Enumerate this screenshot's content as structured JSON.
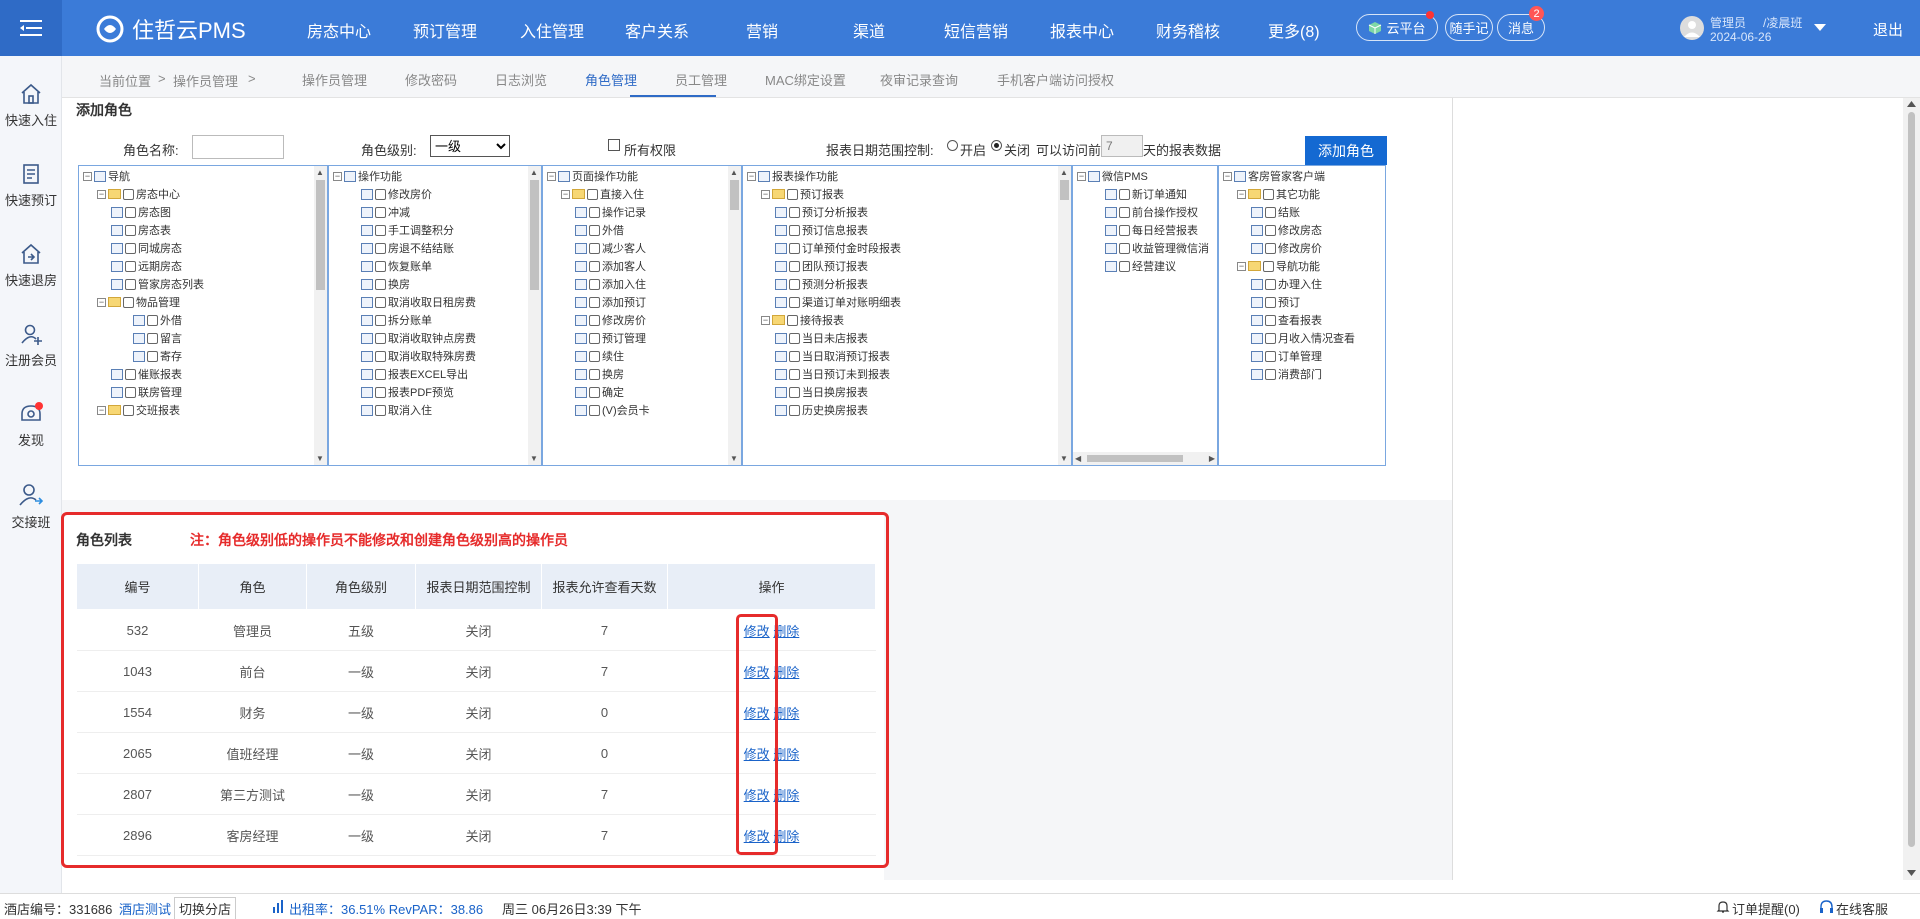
{
  "app": {
    "name": "住哲云PMS"
  },
  "nav": [
    "房态中心",
    "预订管理",
    "入住管理",
    "客户关系",
    "营销",
    "渠道",
    "短信营销",
    "报表中心",
    "财务稽核",
    "更多(8)"
  ],
  "header_actions": {
    "cloud": "云平台",
    "notes": "随手记",
    "messages": "消息",
    "message_count": "2"
  },
  "user": {
    "role": "管理员",
    "shift": "/凌晨班",
    "date": "2024-06-26",
    "logout": "退出"
  },
  "sidebar": [
    {
      "label": "快速入住",
      "icon": "home-icon"
    },
    {
      "label": "快速预订",
      "icon": "clipboard-icon"
    },
    {
      "label": "快速退房",
      "icon": "house-exit-icon"
    },
    {
      "label": "注册会员",
      "icon": "user-add-icon"
    },
    {
      "label": "发现",
      "icon": "discover-icon"
    },
    {
      "label": "交接班",
      "icon": "shift-handover-icon"
    }
  ],
  "breadcrumb": {
    "current": "当前位置",
    "sep": ">",
    "page": "操作员管理",
    "sep2": ">"
  },
  "tabs": [
    "操作员管理",
    "修改密码",
    "日志浏览",
    "角色管理",
    "员工管理",
    "MAC绑定设置",
    "夜审记录查询",
    "手机客户端访问授权"
  ],
  "active_tab": "角色管理",
  "add_role": {
    "title": "添加角色",
    "name_label": "角色名称:",
    "name_value": "",
    "level_label": "角色级别:",
    "level_value": "一级",
    "all_perm_label": "所有权限",
    "report_ctrl_label": "报表日期范围控制:",
    "opt_on": "开启",
    "opt_off": "关闭",
    "days_prefix": "可以访问前",
    "days_value": "7",
    "days_suffix": "天的报表数据",
    "button": "添加角色"
  },
  "trees": [
    {
      "nodes": [
        [
          "导航",
          0,
          "root"
        ],
        [
          "房态中心",
          1,
          "folder"
        ],
        [
          "房态图",
          2,
          "leaf"
        ],
        [
          "房态表",
          2,
          "leaf"
        ],
        [
          "同城房态",
          2,
          "leaf"
        ],
        [
          "远期房态",
          2,
          "leaf"
        ],
        [
          "管家房态列表",
          2,
          "leaf"
        ],
        [
          "物品管理",
          1,
          "folder"
        ],
        [
          "外借",
          3,
          "leaf"
        ],
        [
          "留言",
          3,
          "leaf"
        ],
        [
          "寄存",
          3,
          "leaf"
        ],
        [
          "催账报表",
          2,
          "leaf"
        ],
        [
          "联房管理",
          2,
          "leaf"
        ],
        [
          "交班报表",
          1,
          "folder"
        ]
      ]
    },
    {
      "nodes": [
        [
          "操作功能",
          0,
          "root"
        ],
        [
          "修改房价",
          2,
          "leaf"
        ],
        [
          "冲减",
          2,
          "leaf"
        ],
        [
          "手工调整积分",
          2,
          "leaf"
        ],
        [
          "房退不结结账",
          2,
          "leaf"
        ],
        [
          "恢复账单",
          2,
          "leaf"
        ],
        [
          "换房",
          2,
          "leaf"
        ],
        [
          "取消收取日租房费",
          2,
          "leaf"
        ],
        [
          "拆分账单",
          2,
          "leaf"
        ],
        [
          "取消收取钟点房费",
          2,
          "leaf"
        ],
        [
          "取消收取特殊房费",
          2,
          "leaf"
        ],
        [
          "报表EXCEL导出",
          2,
          "leaf"
        ],
        [
          "报表PDF预览",
          2,
          "leaf"
        ],
        [
          "取消入住",
          2,
          "leaf"
        ]
      ]
    },
    {
      "nodes": [
        [
          "页面操作功能",
          0,
          "root"
        ],
        [
          "直接入住",
          1,
          "folder"
        ],
        [
          "操作记录",
          2,
          "leaf"
        ],
        [
          "外借",
          2,
          "leaf"
        ],
        [
          "减少客人",
          2,
          "leaf"
        ],
        [
          "添加客人",
          2,
          "leaf"
        ],
        [
          "添加入住",
          2,
          "leaf"
        ],
        [
          "添加预订",
          2,
          "leaf"
        ],
        [
          "修改房价",
          2,
          "leaf"
        ],
        [
          "预订管理",
          2,
          "leaf"
        ],
        [
          "续住",
          2,
          "leaf"
        ],
        [
          "换房",
          2,
          "leaf"
        ],
        [
          "确定",
          2,
          "leaf"
        ],
        [
          "(V)会员卡",
          2,
          "leaf"
        ]
      ]
    },
    {
      "nodes": [
        [
          "报表操作功能",
          0,
          "root"
        ],
        [
          "预订报表",
          1,
          "folder"
        ],
        [
          "预订分析报表",
          2,
          "leaf"
        ],
        [
          "预订信息报表",
          2,
          "leaf"
        ],
        [
          "订单预付金时段报表",
          2,
          "leaf"
        ],
        [
          "团队预订报表",
          2,
          "leaf"
        ],
        [
          "预测分析报表",
          2,
          "leaf"
        ],
        [
          "渠道订单对账明细表",
          2,
          "leaf"
        ],
        [
          "接待报表",
          1,
          "folder"
        ],
        [
          "当日未店报表",
          2,
          "leaf"
        ],
        [
          "当日取消预订报表",
          2,
          "leaf"
        ],
        [
          "当日预订未到报表",
          2,
          "leaf"
        ],
        [
          "当日换房报表",
          2,
          "leaf"
        ],
        [
          "历史换房报表",
          2,
          "leaf"
        ]
      ]
    },
    {
      "nodes": [
        [
          "微信PMS",
          0,
          "root"
        ],
        [
          "新订单通知",
          2,
          "leaf"
        ],
        [
          "前台操作授权",
          2,
          "leaf"
        ],
        [
          "每日经营报表",
          2,
          "leaf"
        ],
        [
          "收益管理微信消",
          2,
          "leaf"
        ],
        [
          "经营建议",
          2,
          "leaf"
        ]
      ]
    },
    {
      "nodes": [
        [
          "客房管家客户端",
          0,
          "root"
        ],
        [
          "其它功能",
          1,
          "folder"
        ],
        [
          "结账",
          2,
          "leaf"
        ],
        [
          "修改房态",
          2,
          "leaf"
        ],
        [
          "修改房价",
          2,
          "leaf"
        ],
        [
          "导航功能",
          1,
          "folder"
        ],
        [
          "办理入住",
          2,
          "leaf"
        ],
        [
          "预订",
          2,
          "leaf"
        ],
        [
          "查看报表",
          2,
          "leaf"
        ],
        [
          "月收入情况查看",
          2,
          "leaf"
        ],
        [
          "订单管理",
          2,
          "leaf"
        ],
        [
          "消费部门",
          2,
          "leaf"
        ]
      ]
    }
  ],
  "role_list": {
    "title": "角色列表",
    "note": "注：角色级别低的操作员不能修改和创建角色级别高的操作员",
    "headers": [
      "编号",
      "角色",
      "角色级别",
      "报表日期范围控制",
      "报表允许查看天数",
      "操作"
    ],
    "edit": "修改",
    "delete": "删除",
    "rows": [
      [
        "532",
        "管理员",
        "五级",
        "关闭",
        "7"
      ],
      [
        "1043",
        "前台",
        "一级",
        "关闭",
        "7"
      ],
      [
        "1554",
        "财务",
        "一级",
        "关闭",
        "0"
      ],
      [
        "2065",
        "值班经理",
        "一级",
        "关闭",
        "0"
      ],
      [
        "2807",
        "第三方测试",
        "一级",
        "关闭",
        "7"
      ],
      [
        "2896",
        "客房经理",
        "一级",
        "关闭",
        "7"
      ]
    ]
  },
  "status": {
    "hotel_label": "酒店编号：331686",
    "hotel_name": "酒店测试",
    "switch": "切换分店",
    "occupancy": "出租率：36.51%  RevPAR：38.86",
    "datetime": "周三 06月26日3:39 下午",
    "order_reminder": "订单提醒(0)",
    "service": "在线客服"
  },
  "colors": {
    "brand": "#3b7bd8",
    "accent": "#1469d2",
    "alert": "#e62b2b"
  }
}
